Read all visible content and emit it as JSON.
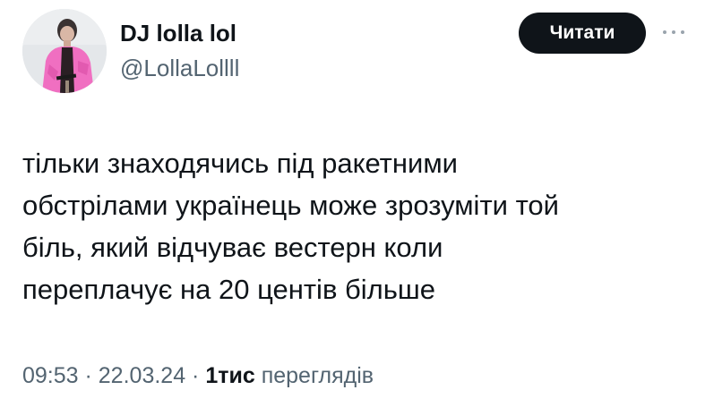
{
  "author": {
    "display_name": "DJ lolla lol",
    "handle": "@LollaLollll",
    "avatar_icon": "user-avatar-photo"
  },
  "actions": {
    "follow_label": "Читати",
    "more_icon": "more-horizontal-icon"
  },
  "tweet": {
    "text": "тільки знаходячись під ракетними\nобстрілами українець може зрозуміти той\nбіль, який відчуває вестерн коли\nпереплачує на 20 центів більше"
  },
  "meta": {
    "time": "09:53",
    "separator": " · ",
    "date": "22.03.24",
    "views_count": "1тис",
    "views_label": " переглядів"
  },
  "colors": {
    "text_primary": "#0f1419",
    "text_secondary": "#536471",
    "button_bg": "#0f1419",
    "button_text": "#ffffff",
    "avatar_jacket": "#f06fc1"
  }
}
